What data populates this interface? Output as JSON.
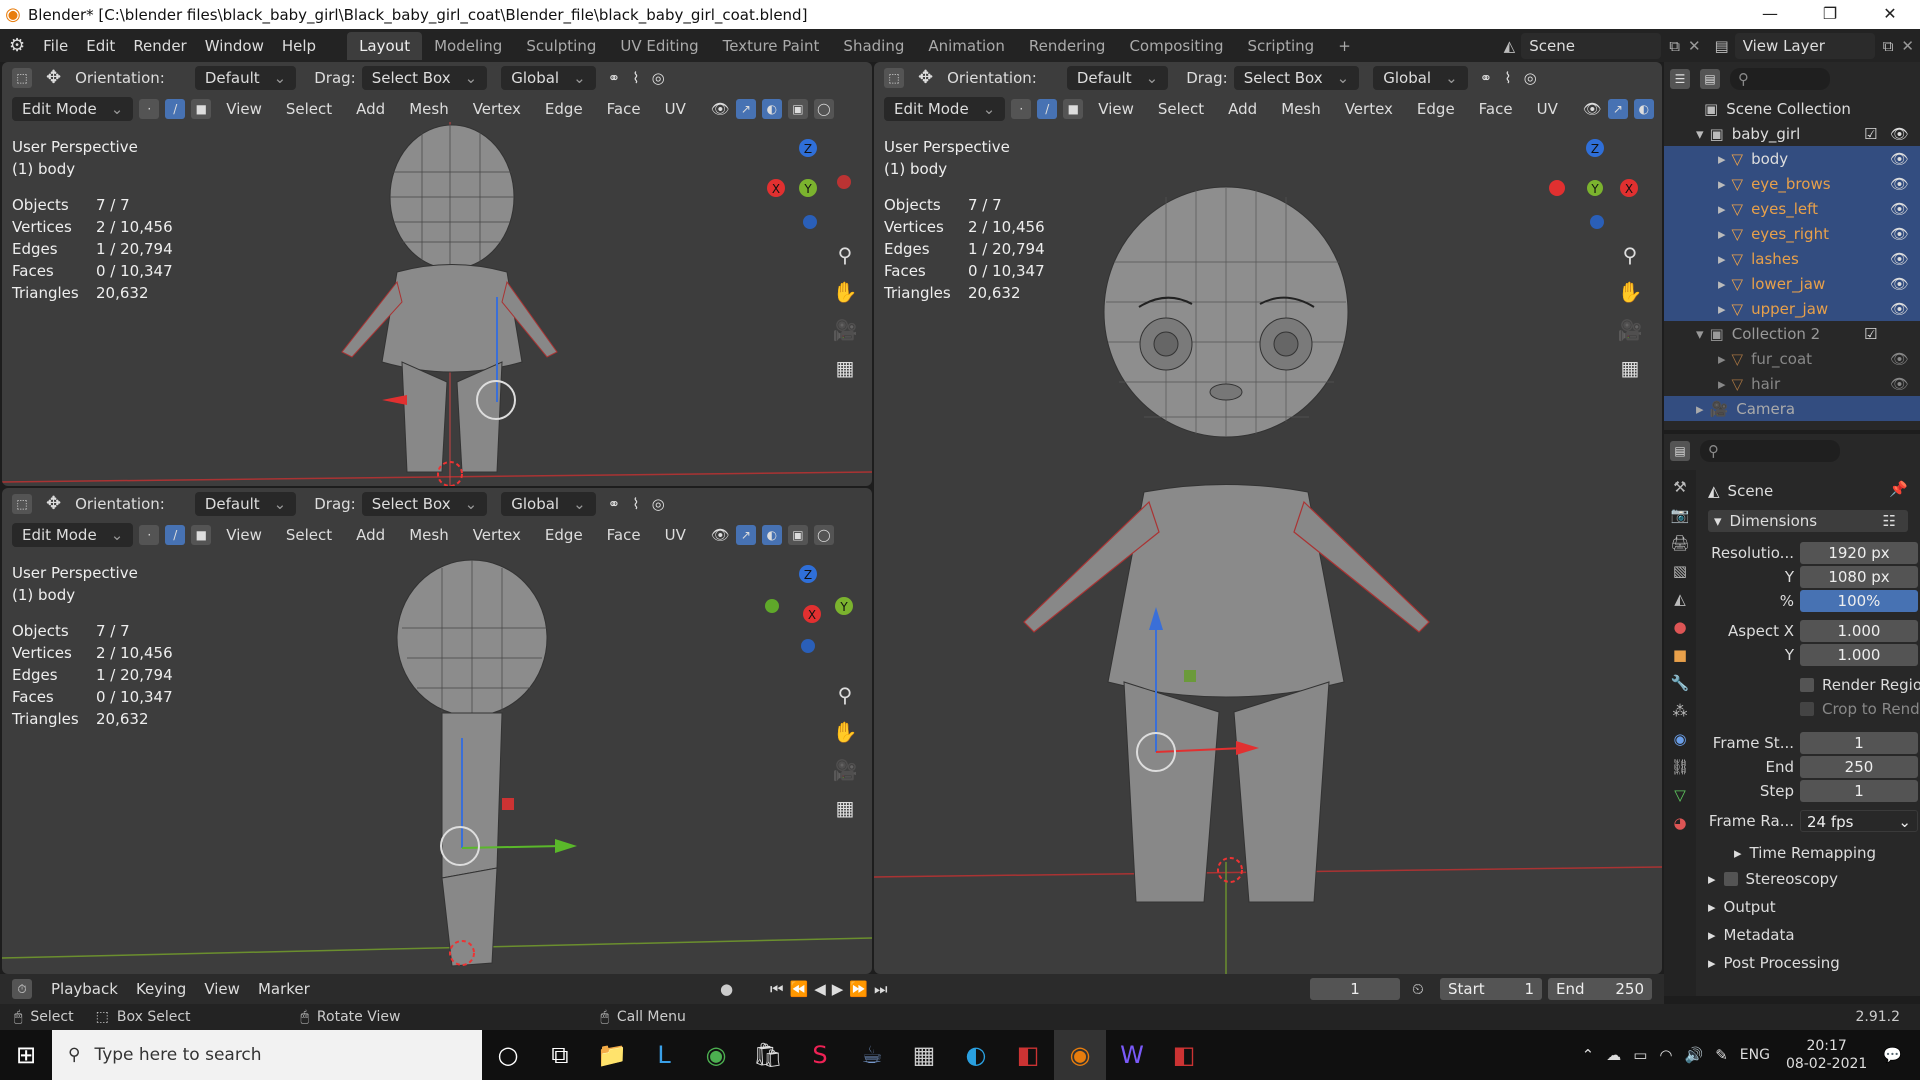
{
  "window": {
    "title": "Blender* [C:\\blender files\\black_baby_girl\\Black_baby_girl_coat\\Blender_file\\black_baby_girl_coat.blend]"
  },
  "menu": [
    "File",
    "Edit",
    "Render",
    "Window",
    "Help"
  ],
  "workspaces": [
    "Layout",
    "Modeling",
    "Sculpting",
    "UV Editing",
    "Texture Paint",
    "Shading",
    "Animation",
    "Rendering",
    "Compositing",
    "Scripting"
  ],
  "topbar": {
    "scene": "Scene",
    "view_layer": "View Layer"
  },
  "tool_header": {
    "orientation_label": "Orientation:",
    "orientation": "Default",
    "drag_label": "Drag:",
    "drag": "Select Box",
    "transform": "Global"
  },
  "mode_header": {
    "mode": "Edit Mode",
    "menus": [
      "View",
      "Select",
      "Add",
      "Mesh",
      "Vertex",
      "Edge",
      "Face",
      "UV"
    ]
  },
  "viewport": {
    "perspective": "User Perspective",
    "object": "(1) body",
    "stats": [
      {
        "k": "Objects",
        "v": "7 / 7"
      },
      {
        "k": "Vertices",
        "v": "2 / 10,456"
      },
      {
        "k": "Edges",
        "v": "1 / 20,794"
      },
      {
        "k": "Faces",
        "v": "0 / 10,347"
      },
      {
        "k": "Triangles",
        "v": "20,632"
      }
    ],
    "gizmo": {
      "x": "X",
      "y": "Y",
      "z": "Z"
    }
  },
  "outliner": {
    "root": "Scene Collection",
    "items": [
      {
        "name": "baby_girl",
        "type": "collection"
      },
      {
        "name": "body",
        "type": "mesh",
        "highlight": true
      },
      {
        "name": "eye_brows",
        "type": "mesh"
      },
      {
        "name": "eyes_left",
        "type": "mesh"
      },
      {
        "name": "eyes_right",
        "type": "mesh"
      },
      {
        "name": "lashes",
        "type": "mesh"
      },
      {
        "name": "lower_jaw",
        "type": "mesh"
      },
      {
        "name": "upper_jaw",
        "type": "mesh"
      },
      {
        "name": "Collection 2",
        "type": "collection"
      },
      {
        "name": "fur_coat",
        "type": "mesh"
      },
      {
        "name": "hair",
        "type": "mesh"
      },
      {
        "name": "Camera",
        "type": "camera"
      }
    ]
  },
  "properties": {
    "context": "Scene",
    "panel": "Dimensions",
    "resolution_label": "Resolutio...",
    "res_x": "1920 px",
    "y_label": "Y",
    "res_y": "1080 px",
    "pct_label": "%",
    "pct": "100%",
    "aspect_label": "Aspect X",
    "aspect_x": "1.000",
    "aspect_y": "1.000",
    "render_region": "Render Region",
    "crop": "Crop to Rend...",
    "frame_start_label": "Frame St...",
    "frame_start": "1",
    "end_label": "End",
    "frame_end": "250",
    "step_label": "Step",
    "step": "1",
    "frame_rate_label": "Frame Ra...",
    "frame_rate": "24 fps",
    "time_remapping": "Time Remapping",
    "subpanels": [
      "Stereoscopy",
      "Output",
      "Metadata",
      "Post Processing"
    ]
  },
  "timeline": {
    "menus": [
      "Playback",
      "Keying",
      "View",
      "Marker"
    ],
    "current_frame": "1",
    "start_label": "Start",
    "start": "1",
    "end_label": "End",
    "end": "250"
  },
  "statusbar": {
    "select": "Select",
    "box_select": "Box Select",
    "rotate": "Rotate View",
    "call_menu": "Call Menu",
    "version": "2.91.2"
  },
  "taskbar": {
    "search_placeholder": "Type here to search",
    "lang": "ENG",
    "time": "20:17",
    "date": "08-02-2021"
  },
  "colors": {
    "accent": "#4772b3",
    "viewport_bg": "#3d3d3d",
    "outliner_highlight": "#334d80",
    "active_edge": "#e14545"
  }
}
